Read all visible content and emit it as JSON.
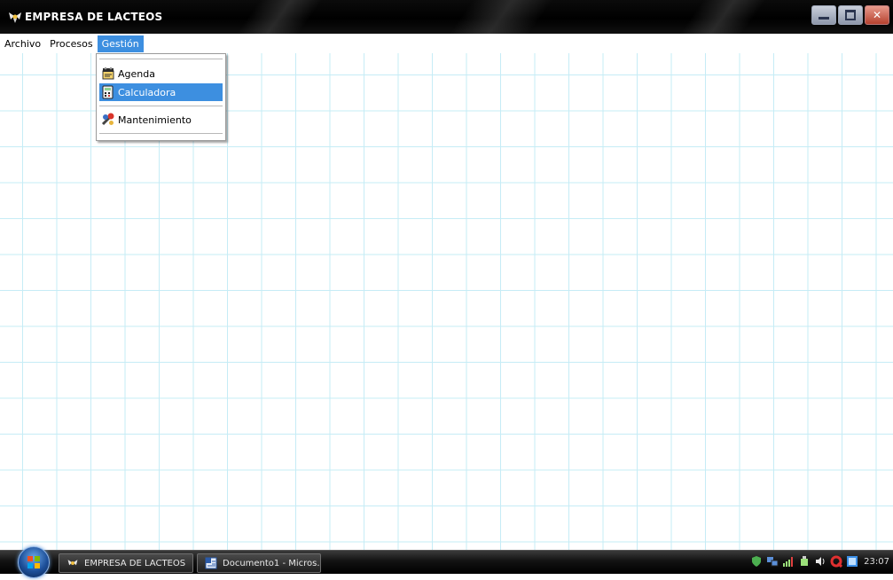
{
  "window": {
    "title": "EMPRESA DE LACTEOS",
    "controls": [
      "minimize-icon",
      "maximize-icon",
      "close-icon"
    ]
  },
  "menubar": {
    "items": [
      {
        "label": "Archivo"
      },
      {
        "label": "Procesos"
      },
      {
        "label": "Gestión",
        "active": true
      }
    ]
  },
  "dropdown": {
    "items": [
      {
        "label": "Agenda",
        "icon": "agenda-icon"
      },
      {
        "label": "Calculadora",
        "icon": "calculator-icon",
        "selected": true
      },
      {
        "label": "Mantenimiento",
        "icon": "maintenance-icon"
      }
    ]
  },
  "taskbar": {
    "buttons": [
      {
        "label": "EMPRESA DE LACTEOS",
        "icon": "app-icon"
      },
      {
        "label": "Documento1 - Micros...",
        "icon": "word-document-icon"
      }
    ],
    "clock": "23:07"
  },
  "colors": {
    "accent": "#3d8fe0",
    "grid": "#c6ecf6",
    "titlebar": "#000000"
  }
}
